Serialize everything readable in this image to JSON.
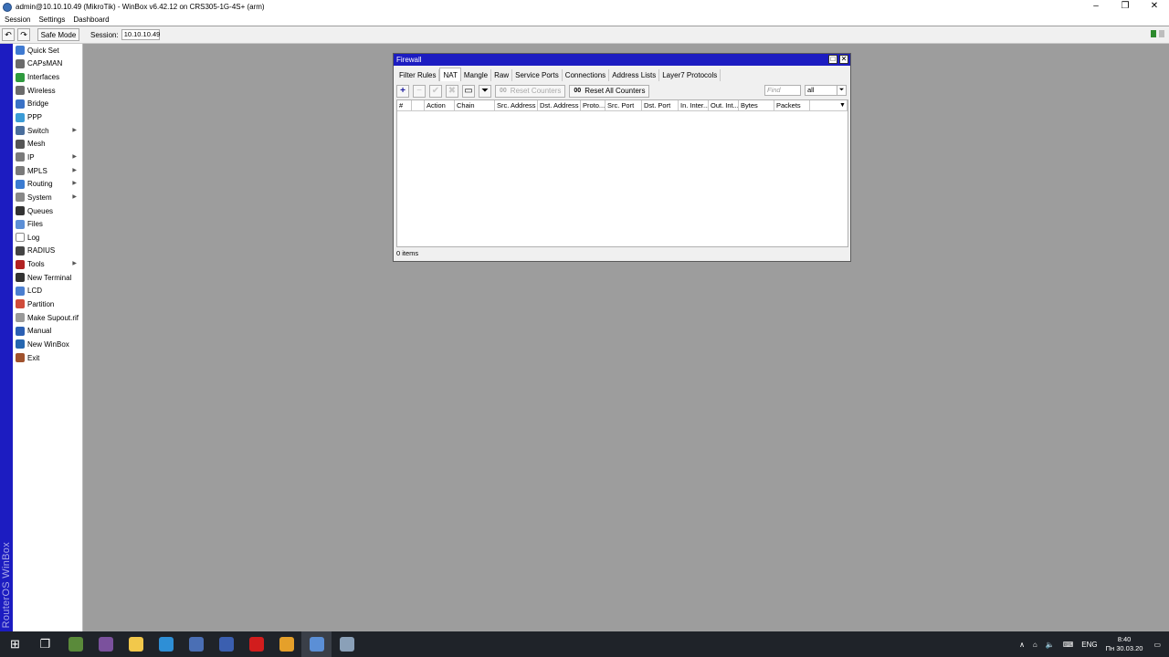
{
  "window": {
    "title": "admin@10.10.10.49 (MikroTik) - WinBox v6.42.12 on CRS305-1G-4S+ (arm)",
    "controls": {
      "minimize": "–",
      "restore": "❐",
      "close": "✕"
    }
  },
  "menubar": {
    "items": [
      "Session",
      "Settings",
      "Dashboard"
    ]
  },
  "toolbar": {
    "undo_icon": "↶",
    "redo_icon": "↷",
    "safe_mode": "Safe Mode",
    "session_label": "Session:",
    "session_value": "10.10.10.49"
  },
  "brand": "RouterOS WinBox",
  "sidebar": {
    "items": [
      {
        "label": "Quick Set",
        "icon": "quickset-icon",
        "color": "#3f7ad1",
        "submenu": false
      },
      {
        "label": "CAPsMAN",
        "icon": "capsman-icon",
        "color": "#6b6b6b",
        "submenu": false
      },
      {
        "label": "Interfaces",
        "icon": "interfaces-icon",
        "color": "#2e9a3e",
        "submenu": false
      },
      {
        "label": "Wireless",
        "icon": "wireless-icon",
        "color": "#6b6b6b",
        "submenu": false
      },
      {
        "label": "Bridge",
        "icon": "bridge-icon",
        "color": "#3a72c6",
        "submenu": false
      },
      {
        "label": "PPP",
        "icon": "ppp-icon",
        "color": "#3a9bd6",
        "submenu": false
      },
      {
        "label": "Switch",
        "icon": "switch-icon",
        "color": "#4a6e9c",
        "submenu": true
      },
      {
        "label": "Mesh",
        "icon": "mesh-icon",
        "color": "#555555",
        "submenu": false
      },
      {
        "label": "IP",
        "icon": "ip-icon",
        "color": "#7a7a7a",
        "submenu": true
      },
      {
        "label": "MPLS",
        "icon": "mpls-icon",
        "color": "#7a7a7a",
        "submenu": true
      },
      {
        "label": "Routing",
        "icon": "routing-icon",
        "color": "#3b7bd1",
        "submenu": true
      },
      {
        "label": "System",
        "icon": "system-icon",
        "color": "#888888",
        "submenu": true
      },
      {
        "label": "Queues",
        "icon": "queues-icon",
        "color": "#333333",
        "submenu": false
      },
      {
        "label": "Files",
        "icon": "files-icon",
        "color": "#5c8fd6",
        "submenu": false
      },
      {
        "label": "Log",
        "icon": "log-icon",
        "color": "#ffffff",
        "submenu": false
      },
      {
        "label": "RADIUS",
        "icon": "radius-icon",
        "color": "#444444",
        "submenu": false
      },
      {
        "label": "Tools",
        "icon": "tools-icon",
        "color": "#b22222",
        "submenu": true
      },
      {
        "label": "New Terminal",
        "icon": "terminal-icon",
        "color": "#333333",
        "submenu": false
      },
      {
        "label": "LCD",
        "icon": "lcd-icon",
        "color": "#4b7fd0",
        "submenu": false
      },
      {
        "label": "Partition",
        "icon": "partition-icon",
        "color": "#d04b3a",
        "submenu": false
      },
      {
        "label": "Make Supout.rif",
        "icon": "supout-icon",
        "color": "#999999",
        "submenu": false
      },
      {
        "label": "Manual",
        "icon": "manual-icon",
        "color": "#2b5fb3",
        "submenu": false
      },
      {
        "label": "New WinBox",
        "icon": "winbox-icon",
        "color": "#2566b0",
        "submenu": false
      },
      {
        "label": "Exit",
        "icon": "exit-icon",
        "color": "#a0522d",
        "submenu": false
      }
    ]
  },
  "firewall": {
    "title": "Firewall",
    "title_buttons": {
      "maximize": "□",
      "close": "✕"
    },
    "tabs": [
      "Filter Rules",
      "NAT",
      "Mangle",
      "Raw",
      "Service Ports",
      "Connections",
      "Address Lists",
      "Layer7 Protocols"
    ],
    "active_tab": "NAT",
    "toolbar": {
      "add_icon": "+",
      "remove_icon": "−",
      "enable_icon": "✔",
      "disable_icon": "✖",
      "comment_icon": "▭",
      "filter_icon": "⏷",
      "reset_counters": "Reset Counters",
      "reset_all_counters": "Reset All Counters",
      "counter_glyph": "00",
      "find_placeholder": "Find",
      "filter_value": "all",
      "filter_caret": "⏷"
    },
    "columns": [
      "#",
      "",
      "Action",
      "Chain",
      "Src. Address",
      "Dst. Address",
      "Proto...",
      "Src. Port",
      "Dst. Port",
      "In. Inter...",
      "Out. Int...",
      "Bytes",
      "Packets"
    ],
    "column_menu_icon": "▼",
    "status": "0 items"
  },
  "taskbar": {
    "start_icon": "⊞",
    "task_view_icon": "❐",
    "apps": [
      {
        "name": "nature-app-icon",
        "color": "#5a8a3a"
      },
      {
        "name": "viber-icon",
        "color": "#7b519d"
      },
      {
        "name": "file-explorer-icon",
        "color": "#f2c84b"
      },
      {
        "name": "edge-icon",
        "color": "#2e8fd6"
      },
      {
        "name": "network-tool-icon",
        "color": "#4a6fb5"
      },
      {
        "name": "security-tool-icon",
        "color": "#3b5fb0"
      },
      {
        "name": "opera-icon",
        "color": "#d21d1d"
      },
      {
        "name": "chrome-icon",
        "color": "#e5a02a"
      },
      {
        "name": "winbox-taskbar-icon",
        "color": "#5b8fd6"
      },
      {
        "name": "generic-app-icon",
        "color": "#8aa0b8"
      }
    ],
    "tray": {
      "chevron": "∧",
      "network": "⌂",
      "volume": "🔈",
      "keyboard": "⌨",
      "language": "ENG",
      "notification": "▭"
    },
    "time": "8:40",
    "date": "Пн 30.03.20"
  }
}
